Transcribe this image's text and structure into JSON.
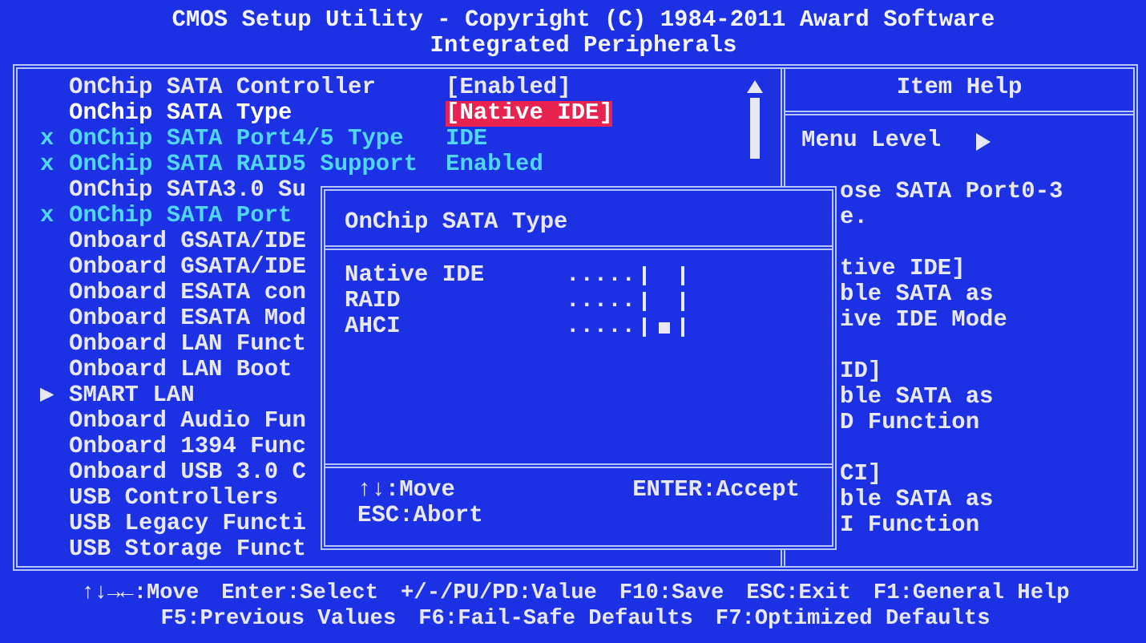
{
  "title_lines": [
    "CMOS Setup Utility - Copyright (C) 1984-2011 Award Software",
    "Integrated Peripherals"
  ],
  "menu": {
    "items": [
      {
        "kind": "normal",
        "marker": "",
        "label": "OnChip SATA Controller",
        "value": "[Enabled]",
        "selected": false
      },
      {
        "kind": "normal",
        "marker": "",
        "label": "OnChip SATA Type",
        "value": "[Native IDE]",
        "selected": true
      },
      {
        "kind": "disabled",
        "marker": "x",
        "label": "OnChip SATA Port4/5 Type",
        "value": "IDE",
        "selected": false
      },
      {
        "kind": "disabled",
        "marker": "x",
        "label": "OnChip SATA RAID5 Support",
        "value": "Enabled",
        "selected": false
      },
      {
        "kind": "normal",
        "marker": "",
        "label": "OnChip SATA3.0 Su",
        "selected": false
      },
      {
        "kind": "disabled",
        "marker": "x",
        "label": "OnChip SATA Port",
        "selected": false
      },
      {
        "kind": "normal",
        "marker": "",
        "label": "Onboard GSATA/IDE",
        "selected": false
      },
      {
        "kind": "normal",
        "marker": "",
        "label": "Onboard GSATA/IDE",
        "selected": false
      },
      {
        "kind": "normal",
        "marker": "",
        "label": "Onboard ESATA con",
        "selected": false
      },
      {
        "kind": "normal",
        "marker": "",
        "label": "Onboard ESATA Mod",
        "selected": false
      },
      {
        "kind": "normal",
        "marker": "",
        "label": "Onboard LAN Funct",
        "selected": false
      },
      {
        "kind": "normal",
        "marker": "",
        "label": "Onboard LAN Boot",
        "selected": false
      },
      {
        "kind": "submenu",
        "marker": "▶",
        "label": "SMART LAN",
        "selected": false
      },
      {
        "kind": "normal",
        "marker": "",
        "label": "Onboard Audio Fun",
        "selected": false
      },
      {
        "kind": "normal",
        "marker": "",
        "label": "Onboard 1394 Func",
        "selected": false
      },
      {
        "kind": "normal",
        "marker": "",
        "label": "Onboard USB 3.0 C",
        "selected": false
      },
      {
        "kind": "normal",
        "marker": "",
        "label": "USB Controllers",
        "selected": false
      },
      {
        "kind": "normal",
        "marker": "",
        "label": "USB Legacy Functi",
        "selected": false
      },
      {
        "kind": "normal",
        "marker": "",
        "label": "USB Storage Funct",
        "selected": false
      }
    ]
  },
  "help": {
    "title": "Item Help",
    "menu_level": "Menu Level",
    "paragraphs": [
      [
        "ose SATA Port0-3",
        "e."
      ],
      [
        "tive IDE]",
        "ble SATA as",
        "ive IDE Mode"
      ],
      [
        "ID]",
        "ble SATA as",
        "D Function"
      ],
      [
        "CI]",
        "ble SATA as",
        "I Function"
      ]
    ]
  },
  "dialog": {
    "title": "OnChip SATA Type",
    "options": [
      {
        "label": "Native IDE",
        "dots": ".....",
        "checked": false
      },
      {
        "label": "RAID",
        "dots": ".....",
        "checked": false
      },
      {
        "label": "AHCI",
        "dots": ".....",
        "checked": true
      }
    ],
    "hints_left": [
      "↑↓:Move",
      "ESC:Abort"
    ],
    "hint_right": "ENTER:Accept"
  },
  "key_hints": [
    [
      "↑↓→←:Move",
      "Enter:Select",
      "+/-/PU/PD:Value",
      "F10:Save",
      "ESC:Exit",
      "F1:General Help"
    ],
    [
      "F5:Previous Values",
      "F6:Fail-Safe Defaults",
      "F7:Optimized Defaults"
    ]
  ]
}
